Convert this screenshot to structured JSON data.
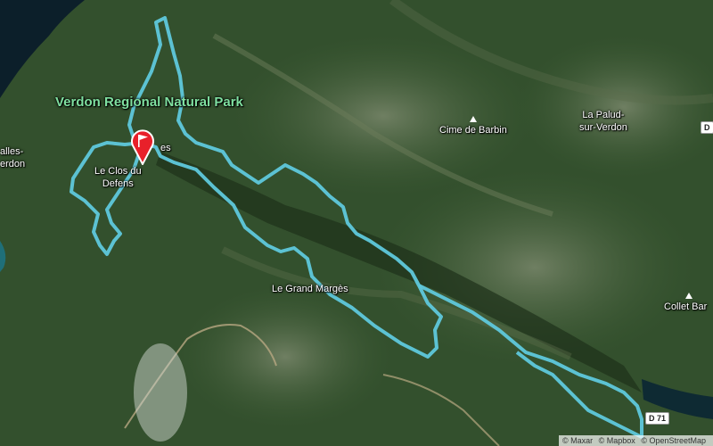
{
  "map": {
    "labels": {
      "park": "Verdon Regional Natural Park",
      "village_left": "alles-\nerdon",
      "clos": "Le Clos du\nDefens",
      "les": "es",
      "cime": "Cime de Barbin",
      "palud": "La Palud-\nsur-Verdon",
      "grand_marges": "Le Grand Margès",
      "collet": "Collet Bar"
    },
    "roads": {
      "d71": "D 71",
      "d_right": "D"
    },
    "attribution": {
      "maxar": "© Maxar",
      "mapbox": "© Mapbox",
      "osm": "© OpenStreetMap"
    },
    "icons": {
      "peak": "peak-triangle-icon",
      "start": "start-flag-marker-icon"
    },
    "colors": {
      "route": "#5fc8dc",
      "park_label": "#7fe0a0",
      "marker": "#e8202a"
    }
  }
}
